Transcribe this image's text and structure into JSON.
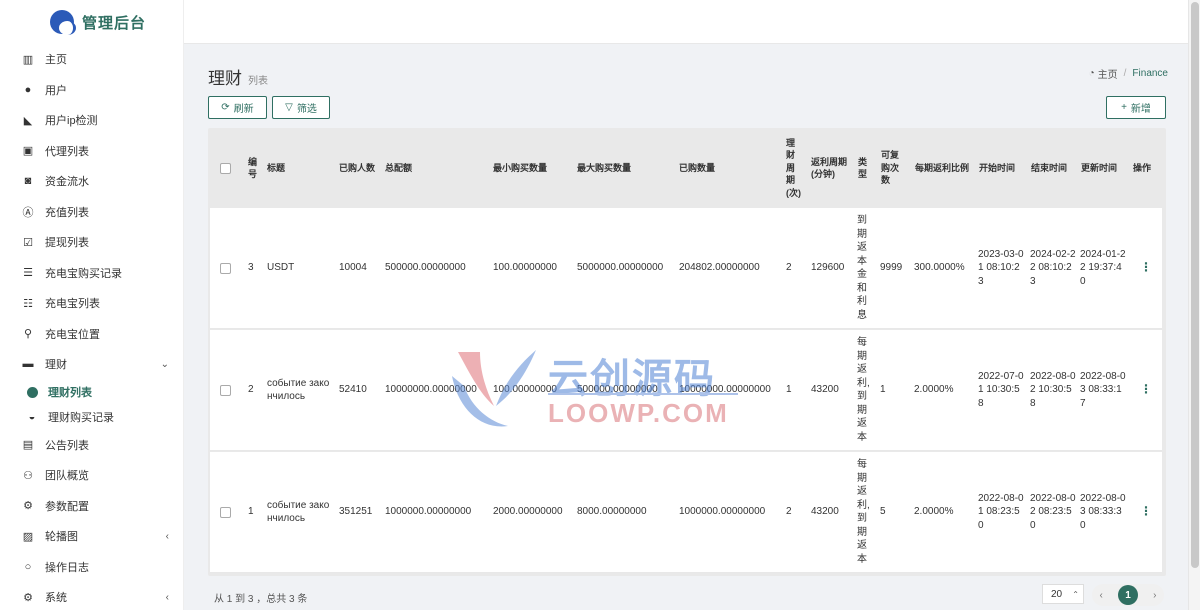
{
  "app": {
    "title": "管理后台"
  },
  "sidebar": {
    "items": [
      {
        "label": "主页",
        "icon": "bar-chart-icon"
      },
      {
        "label": "用户",
        "icon": "user-icon"
      },
      {
        "label": "用户ip检测",
        "icon": "area-chart-icon"
      },
      {
        "label": "代理列表",
        "icon": "address-book-icon"
      },
      {
        "label": "资金流水",
        "icon": "money-icon"
      },
      {
        "label": "充值列表",
        "icon": "font-icon"
      },
      {
        "label": "提现列表",
        "icon": "check-square-icon"
      },
      {
        "label": "充电宝购买记录",
        "icon": "list-icon"
      },
      {
        "label": "充电宝列表",
        "icon": "list-alt-icon"
      },
      {
        "label": "充电宝位置",
        "icon": "map-marker-icon"
      },
      {
        "label": "理财",
        "icon": "archive-icon"
      },
      {
        "label": "理财列表",
        "icon": "active-dot-icon"
      },
      {
        "label": "理财购买记录",
        "icon": "bath-icon"
      },
      {
        "label": "公告列表",
        "icon": "file-icon"
      },
      {
        "label": "团队概览",
        "icon": "users-icon"
      },
      {
        "label": "参数配置",
        "icon": "cogs-icon"
      },
      {
        "label": "轮播图",
        "icon": "image-icon"
      },
      {
        "label": "操作日志",
        "icon": "circle-icon"
      },
      {
        "label": "系统",
        "icon": "gear-icon"
      }
    ]
  },
  "page": {
    "title": "理财",
    "subtitle": "列表"
  },
  "breadcrumb": {
    "home": "主页",
    "current": "Finance"
  },
  "toolbar": {
    "refresh": "刷新",
    "filter": "筛选",
    "add": "新增"
  },
  "table": {
    "headers": {
      "id": "编号",
      "title": "标题",
      "buyers": "已购人数",
      "total": "总配额",
      "min_buy": "最小购买数量",
      "max_buy": "最大购买数量",
      "bought": "已购数量",
      "period": "理财周期(次)",
      "rebate_period": "返利周期(分钟)",
      "type": "类型",
      "repurchase": "可复购次数",
      "ratio": "每期返利比例",
      "start": "开始时间",
      "end": "结束时间",
      "updated": "更新时间",
      "ops": "操作"
    },
    "rows": [
      {
        "id": "3",
        "title": "USDT",
        "buyers": "10004",
        "total": "500000.00000000",
        "min_buy": "100.00000000",
        "max_buy": "5000000.00000000",
        "bought": "204802.00000000",
        "period": "2",
        "rebate_period": "129600",
        "type": "到期返本金和利息",
        "repurchase": "9999",
        "ratio": "300.0000%",
        "start": "2023-03-01 08:10:23",
        "end": "2024-02-22 08:10:23",
        "updated": "2024-01-22 19:37:40"
      },
      {
        "id": "2",
        "title": "событие закончилось",
        "buyers": "52410",
        "total": "10000000.00000000",
        "min_buy": "100.00000000",
        "max_buy": "500000.00000000",
        "bought": "10000000.00000000",
        "period": "1",
        "rebate_period": "43200",
        "type": "每期返利,到期返本",
        "repurchase": "1",
        "ratio": "2.0000%",
        "start": "2022-07-01 10:30:58",
        "end": "2022-08-02 10:30:58",
        "updated": "2022-08-03 08:33:17"
      },
      {
        "id": "1",
        "title": "событие закончилось",
        "buyers": "351251",
        "total": "1000000.00000000",
        "min_buy": "2000.00000000",
        "max_buy": "8000.00000000",
        "bought": "1000000.00000000",
        "period": "2",
        "rebate_period": "43200",
        "type": "每期返利,到期返本",
        "repurchase": "5",
        "ratio": "2.0000%",
        "start": "2022-08-01 08:23:50",
        "end": "2022-08-02 08:23:50",
        "updated": "2022-08-03 08:33:30"
      }
    ]
  },
  "footer": {
    "summary": "从 1 到 3 ，总共 3 条",
    "page_size": "20",
    "current_page": "1",
    "prev": "‹",
    "next": "›"
  },
  "watermark": {
    "cn": "云创源码",
    "en": "LOOWP.COM"
  },
  "colors": {
    "accent": "#2f6f62",
    "header_bg": "#e9e9e9",
    "page_bg": "#f0f2f5"
  }
}
